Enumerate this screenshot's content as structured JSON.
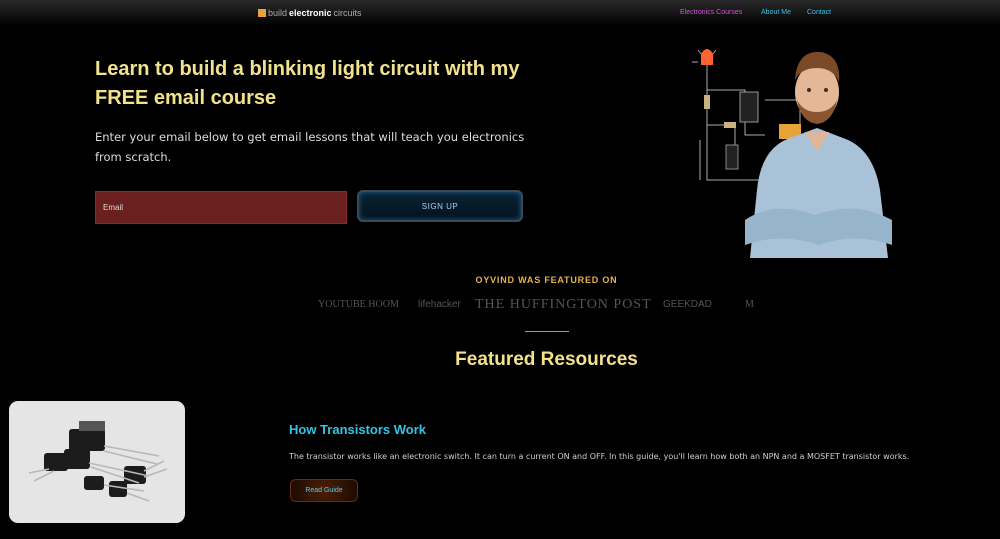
{
  "header": {
    "logo_text_pre": "build",
    "logo_text_bold": "electronic",
    "logo_text_post": "circuits",
    "nav": [
      "Electronics Courses",
      "About Me",
      "Contact"
    ]
  },
  "hero": {
    "title": "Learn to build a blinking light circuit with my FREE email course",
    "subtitle": "Enter your email below to get email lessons that will teach you electronics from scratch.",
    "email_placeholder": "Email",
    "signup_label": "SIGN UP"
  },
  "press": {
    "heading": "OYVIND WAS FEATURED ON",
    "logos": [
      "YOUTUBE HOOM",
      "lifehacker",
      "THE HUFFINGTON POST",
      "GEEKDAD",
      "M"
    ]
  },
  "featured": {
    "title": "Featured Resources",
    "resource_title": "How Transistors Work",
    "resource_desc": "The transistor works like an electronic switch. It can turn a current ON and OFF. In this guide, you'll learn how both an NPN and a MOSFET transistor works.",
    "read_label": "Read Guide"
  },
  "colors": {
    "accent_yellow": "#f2e28c",
    "accent_cyan": "#34c3e4",
    "accent_orange": "#e8b24d"
  }
}
